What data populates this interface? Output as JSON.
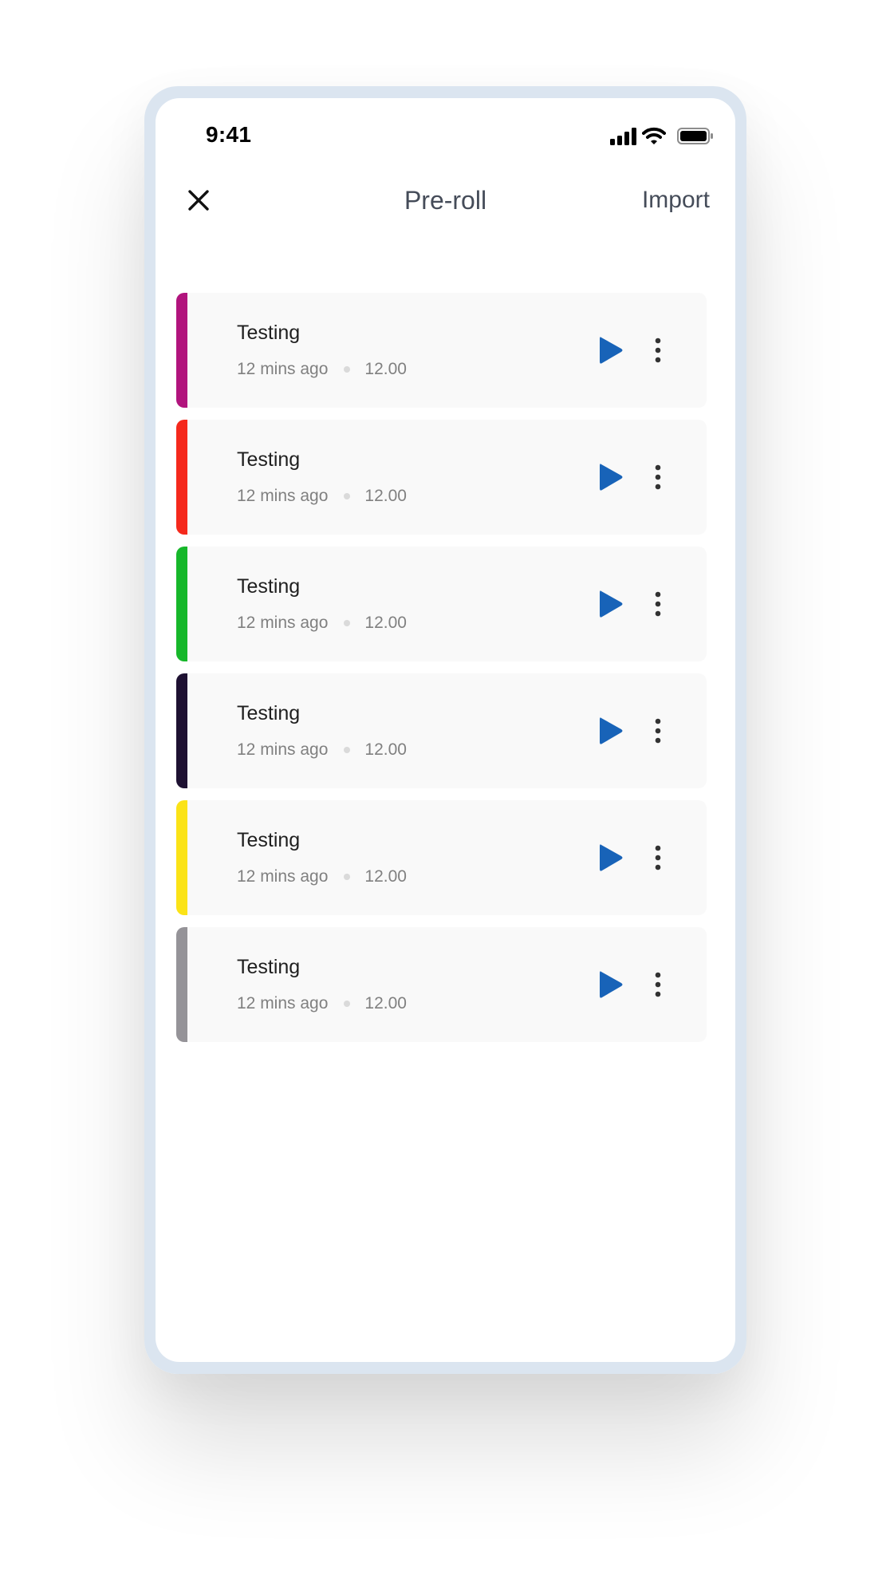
{
  "status_bar": {
    "time": "9:41",
    "icons": [
      "cellular-signal-icon",
      "wifi-icon",
      "battery-icon"
    ]
  },
  "header": {
    "title": "Pre-roll",
    "close_icon": "close-icon",
    "import_label": "Import"
  },
  "colors": {
    "accent": "#1863b8",
    "title_text": "#454c59",
    "frame": "#dbe5f0",
    "card_bg": "#f9f9f9"
  },
  "items": [
    {
      "title": "Testing",
      "time": "12 mins ago",
      "value": "12.00",
      "color": "#b1147d"
    },
    {
      "title": "Testing",
      "time": "12 mins ago",
      "value": "12.00",
      "color": "#f5291c"
    },
    {
      "title": "Testing",
      "time": "12 mins ago",
      "value": "12.00",
      "color": "#16b72a"
    },
    {
      "title": "Testing",
      "time": "12 mins ago",
      "value": "12.00",
      "color": "#1e1132"
    },
    {
      "title": "Testing",
      "time": "12 mins ago",
      "value": "12.00",
      "color": "#fbe317"
    },
    {
      "title": "Testing",
      "time": "12 mins ago",
      "value": "12.00",
      "color": "#959398"
    }
  ]
}
